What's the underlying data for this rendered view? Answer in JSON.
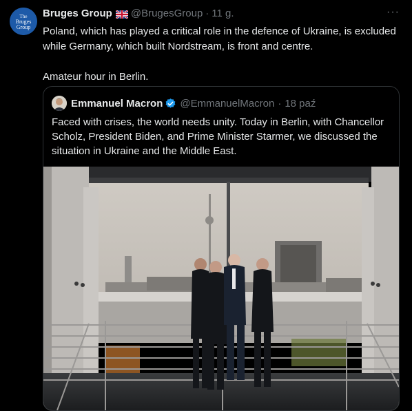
{
  "tweet": {
    "author_name": "Bruges Group",
    "author_handle": "@BrugesGroup",
    "time": "11 g.",
    "avatar_text": "The Bruges Group",
    "paragraphs": [
      "Poland, which has played a critical role in the defence of Ukraine, is excluded while Germany, which built Nordstream, is front and centre.",
      "Amateur hour in Berlin."
    ],
    "more_label": "···"
  },
  "quoted": {
    "author_name": "Emmanuel Macron",
    "author_handle": "@EmmanuelMacron",
    "time": "18 paź",
    "text": "Faced with crises, the world needs unity. Today in Berlin, with Chancellor Scholz, President Biden, and Prime Minister Starmer, we discussed the situation in Ukraine and the Middle East."
  },
  "icons": {
    "flag": "uk-flag-icon",
    "verified": "verified-badge-icon",
    "more": "more-options-icon"
  },
  "colors": {
    "background": "#000000",
    "text": "#e7e9ea",
    "secondary": "#71767b",
    "border": "#2f3336",
    "verified": "#1d9bf0",
    "avatar_bg": "#1d5aa8"
  }
}
